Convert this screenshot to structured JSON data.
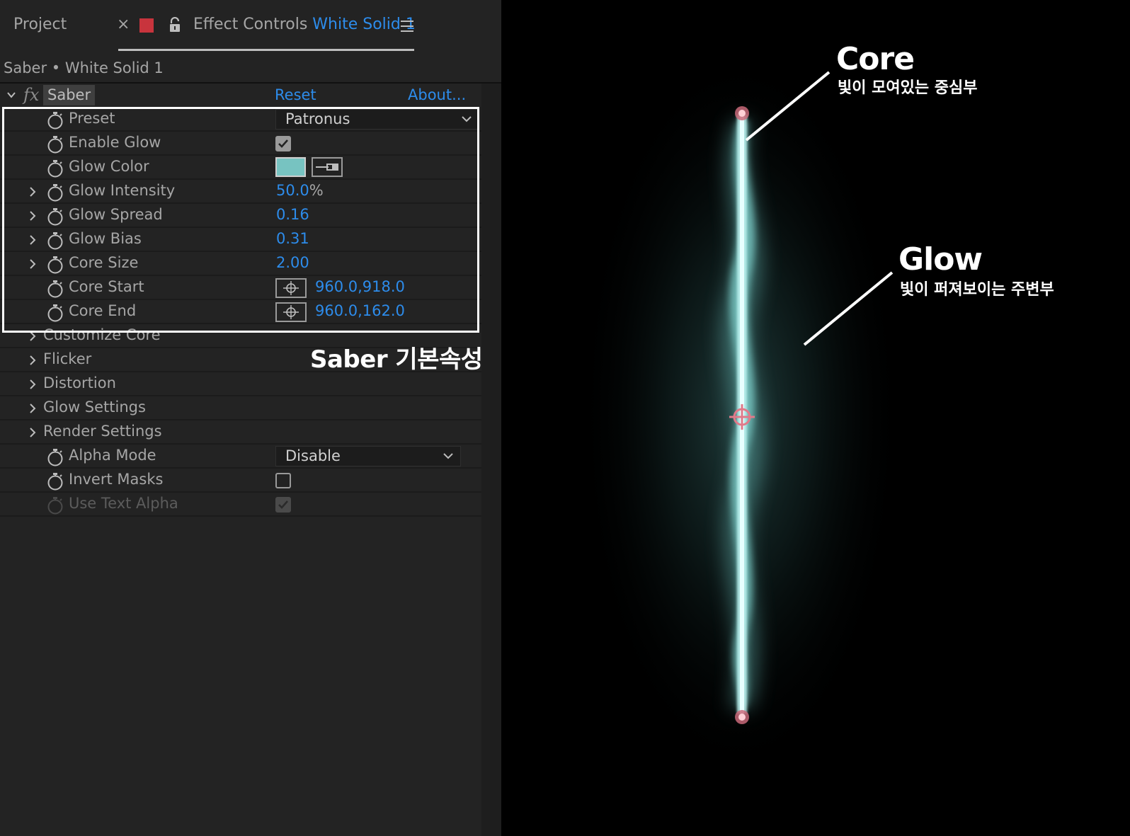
{
  "tabs": {
    "project": "Project",
    "close": "×",
    "effect_controls_prefix": "Effect Controls",
    "effect_controls_layer": "White Solid 1"
  },
  "breadcrumb": "Saber • White Solid 1",
  "effect": {
    "fx": "fx",
    "name": "Saber",
    "reset": "Reset",
    "about": "About..."
  },
  "properties": {
    "preset": {
      "label": "Preset",
      "value": "Patronus"
    },
    "enable_glow": {
      "label": "Enable Glow",
      "checked": true
    },
    "glow_color": {
      "label": "Glow Color",
      "color": "#77c3c1"
    },
    "glow_intensity": {
      "label": "Glow Intensity",
      "value": "50.0",
      "unit": "%"
    },
    "glow_spread": {
      "label": "Glow Spread",
      "value": "0.16"
    },
    "glow_bias": {
      "label": "Glow Bias",
      "value": "0.31"
    },
    "core_size": {
      "label": "Core Size",
      "value": "2.00"
    },
    "core_start": {
      "label": "Core Start",
      "value": "960.0,918.0"
    },
    "core_end": {
      "label": "Core End",
      "value": "960.0,162.0"
    }
  },
  "groups": {
    "customize_core": "Customize Core",
    "flicker": "Flicker",
    "distortion": "Distortion",
    "glow_settings": "Glow Settings",
    "render_settings": "Render Settings"
  },
  "render": {
    "alpha_mode": {
      "label": "Alpha Mode",
      "value": "Disable"
    },
    "invert_masks": {
      "label": "Invert Masks",
      "checked": false
    },
    "use_text_alpha": {
      "label": "Use Text Alpha",
      "checked": true,
      "disabled": true
    }
  },
  "caption": "Saber 기본속성",
  "annotations": {
    "core_title": "Core",
    "core_desc": "빛이 모여있는 중심부",
    "glow_title": "Glow",
    "glow_desc": "빛이 퍼져보이는 주변부"
  },
  "colors": {
    "accent_blue": "#2d8ceb",
    "label_gray": "#a6a6a6",
    "panel_bg": "#232323",
    "label_red": "#c8343d",
    "glow": "#77c3c1",
    "core": "#e8ffff"
  }
}
